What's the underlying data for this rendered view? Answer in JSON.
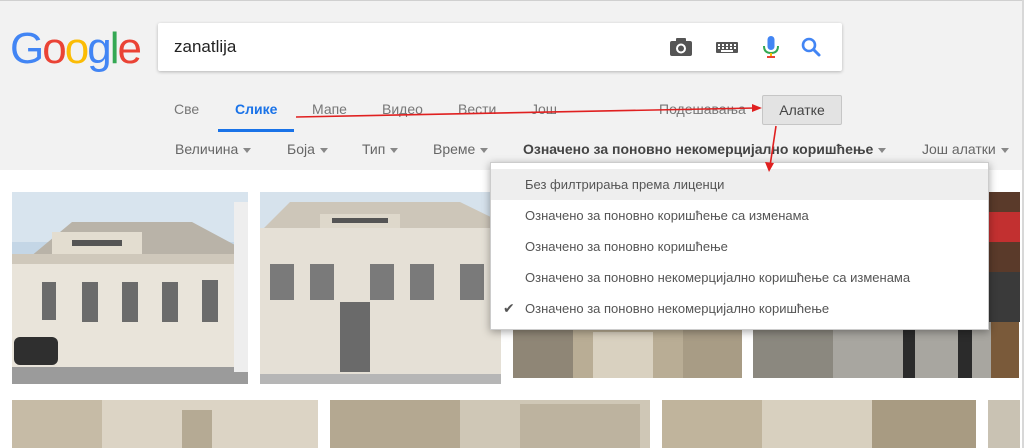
{
  "logo": {
    "letters": [
      "G",
      "o",
      "o",
      "g",
      "l",
      "e"
    ],
    "colors": [
      "#4285F4",
      "#EA4335",
      "#FBBC05",
      "#4285F4",
      "#34A853",
      "#EA4335"
    ]
  },
  "search": {
    "value": "zanatlija"
  },
  "icons": {
    "camera": "camera-icon",
    "keyboard": "keyboard-icon",
    "mic": "microphone-icon",
    "search": "search-icon"
  },
  "tabs": [
    {
      "label": "Све"
    },
    {
      "label": "Слике",
      "active": true
    },
    {
      "label": "Мапе"
    },
    {
      "label": "Видео"
    },
    {
      "label": "Вести"
    },
    {
      "label": "Још"
    }
  ],
  "settings_label": "Подешавања",
  "tools_label": "Алатке",
  "filters": [
    {
      "label": "Величина"
    },
    {
      "label": "Боја"
    },
    {
      "label": "Тип"
    },
    {
      "label": "Време"
    },
    {
      "label": "Означено за поновно некомерцијално коришћење"
    },
    {
      "label": "Још алатки"
    }
  ],
  "license_menu": {
    "items": [
      {
        "label": "Без филтрирања према лиценци",
        "highlighted": true
      },
      {
        "label": "Означено за поновно коришћење са изменама"
      },
      {
        "label": "Означено за поновно коришћење"
      },
      {
        "label": "Означено за поновно некомерцијално коришћење са изменама"
      },
      {
        "label": "Означено за поновно некомерцијално коришћење",
        "checked": true
      }
    ]
  },
  "colors": {
    "accent": "#1a73e8",
    "annotation": "#e02020"
  }
}
